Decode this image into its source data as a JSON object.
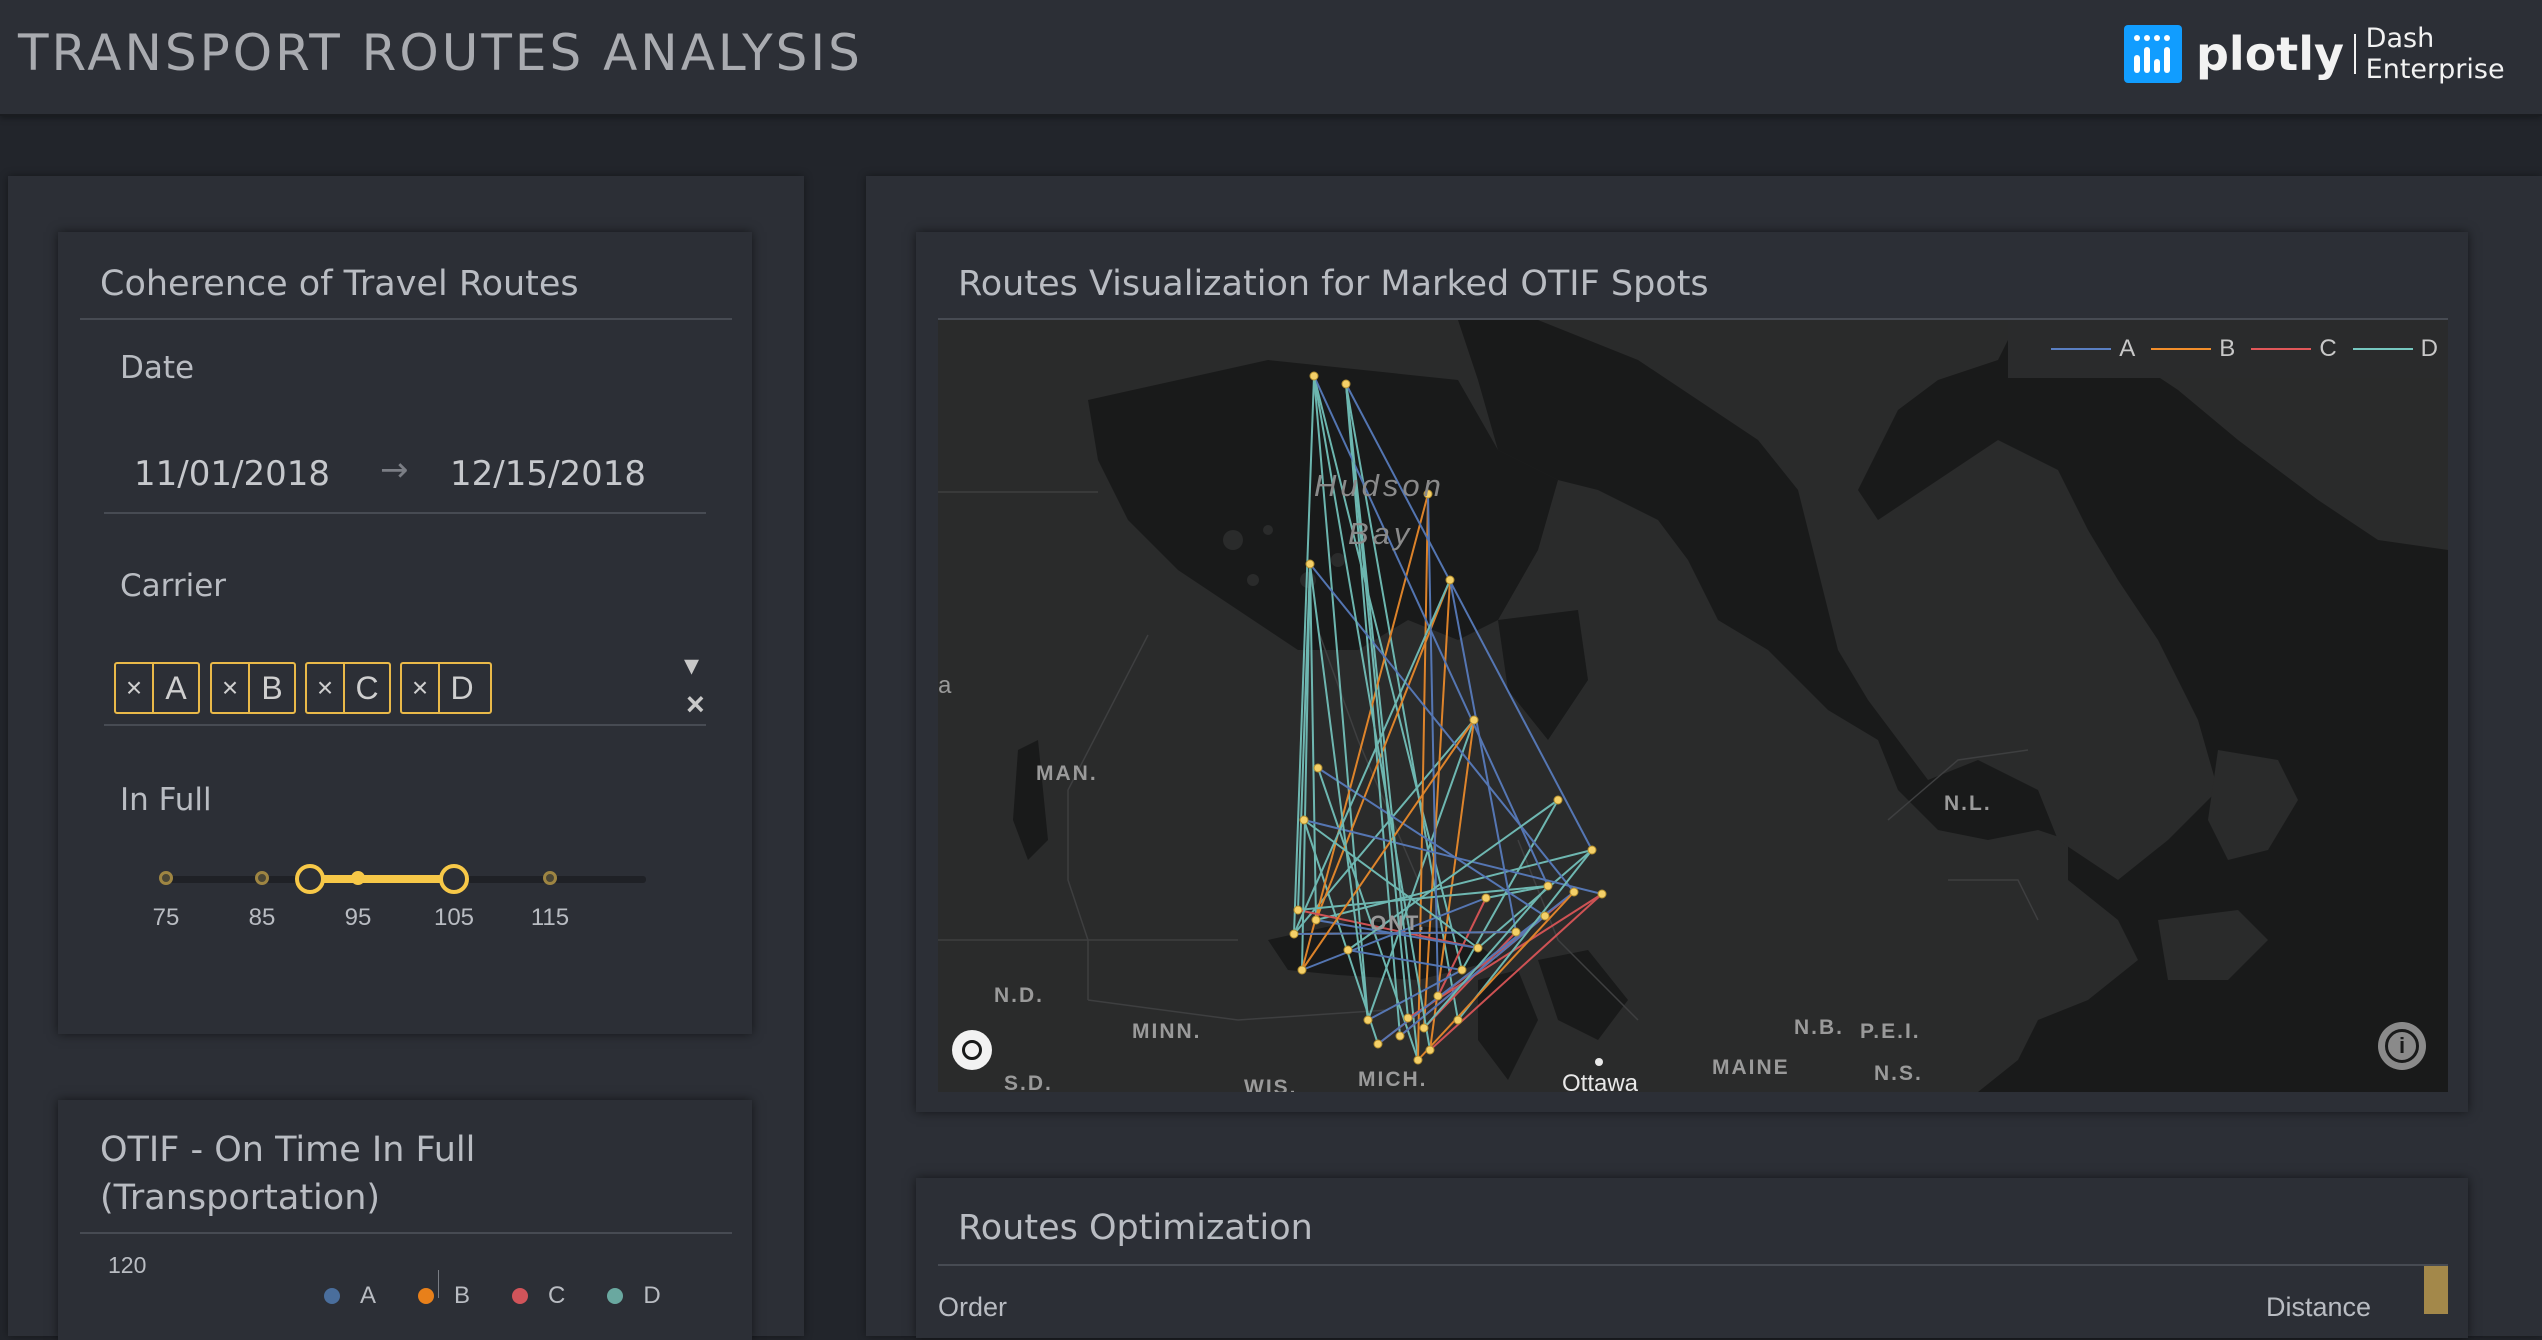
{
  "app": {
    "title": "TRANSPORT ROUTES ANALYSIS"
  },
  "brand": {
    "logo_word": "plotly",
    "logo_product": "Dash Enterprise",
    "accent": "#119dff"
  },
  "filters": {
    "title": "Coherence of Travel Routes",
    "date_label": "Date",
    "date_start": "11/01/2018",
    "date_arrow": "→",
    "date_end": "12/15/2018",
    "carrier_label": "Carrier",
    "carriers": [
      "A",
      "B",
      "C",
      "D"
    ],
    "remove_glyph": "×",
    "dropdown_glyph": "▾",
    "clear_glyph": "×",
    "infull_label": "In Full",
    "slider_ticks": [
      "75",
      "85",
      "95",
      "105",
      "115"
    ],
    "slider_range": [
      90,
      105
    ],
    "highlight_color": "#f7c848"
  },
  "otif": {
    "title_line1": "OTIF - On Time In Full",
    "title_line2": "(Transportation)",
    "y_tick_top": "120",
    "legend": [
      {
        "name": "A",
        "color": "#4a6e9c"
      },
      {
        "name": "B",
        "color": "#e8801a"
      },
      {
        "name": "C",
        "color": "#d1545a"
      },
      {
        "name": "D",
        "color": "#6aa8a0"
      }
    ]
  },
  "map_card": {
    "title": "Routes Visualization for Marked OTIF Spots",
    "legend": [
      {
        "name": "A",
        "color": "#5a7fc2"
      },
      {
        "name": "B",
        "color": "#f28e2b"
      },
      {
        "name": "C",
        "color": "#e15759"
      },
      {
        "name": "D",
        "color": "#76c7c0"
      }
    ],
    "labels": {
      "hudson1": "Hudson",
      "hudson2": "Bay",
      "man": "MAN.",
      "ont": "ONT.",
      "nd": "N.D.",
      "minn": "MINN.",
      "sd": "S.D.",
      "wis": "WIS.",
      "mich": "MICH.",
      "ottawa": "Ottawa",
      "maine": "MAINE",
      "nb": "N.B.",
      "pei": "P.E.I.",
      "ns": "N.S.",
      "nl": "N.L.",
      "edge": "a"
    },
    "info_glyph": "i"
  },
  "optimization": {
    "title": "Routes Optimization",
    "col_order": "Order",
    "col_distance": "Distance"
  }
}
